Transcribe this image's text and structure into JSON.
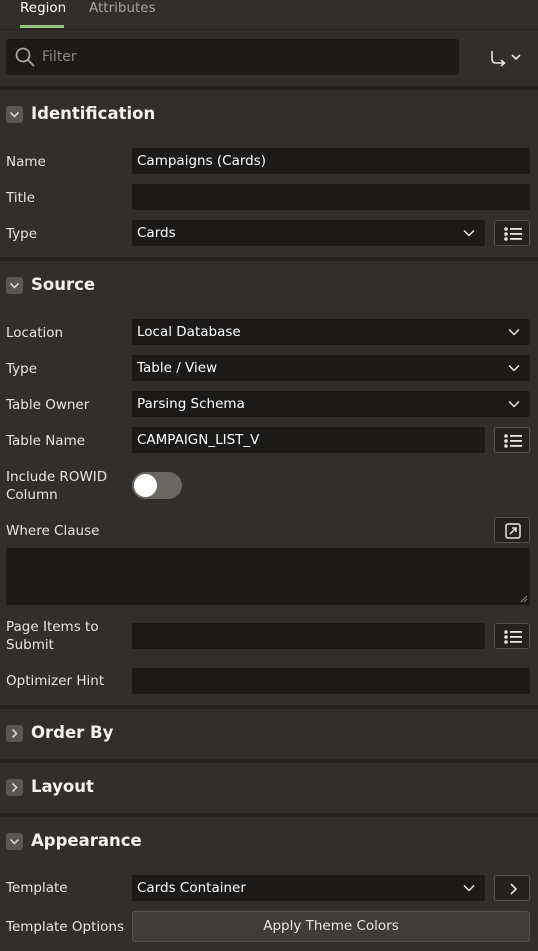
{
  "tabs": {
    "region": "Region",
    "attributes": "Attributes"
  },
  "filter": {
    "placeholder": "Filter"
  },
  "sections": {
    "identification": {
      "title": "Identification",
      "name_label": "Name",
      "name_value": "Campaigns (Cards)",
      "title_label": "Title",
      "title_value": "",
      "type_label": "Type",
      "type_value": "Cards"
    },
    "source": {
      "title": "Source",
      "location_label": "Location",
      "location_value": "Local Database",
      "type_label": "Type",
      "type_value": "Table / View",
      "owner_label": "Table Owner",
      "owner_value": "Parsing Schema",
      "table_label": "Table Name",
      "table_value": "CAMPAIGN_LIST_V",
      "rowid_label_1": "Include ROWID",
      "rowid_label_2": "Column",
      "rowid_on": false,
      "where_label": "Where Clause",
      "where_value": "",
      "items_label_1": "Page Items to",
      "items_label_2": "Submit",
      "items_value": "",
      "hint_label": "Optimizer Hint",
      "hint_value": ""
    },
    "order_by": {
      "title": "Order By"
    },
    "layout": {
      "title": "Layout"
    },
    "appearance": {
      "title": "Appearance",
      "template_label": "Template",
      "template_value": "Cards Container",
      "options_label": "Template Options",
      "apply_label": "Apply Theme Colors"
    }
  },
  "icons": {
    "search": "search-icon",
    "goto": "goto-group-icon",
    "list": "list-icon",
    "expand": "expand-icon",
    "chevron": "chevron-down-icon",
    "collapse": "chevron-right-icon"
  },
  "colors": {
    "accent": "#94c57c",
    "panel": "#312e2b",
    "field": "#1c1a18",
    "separator": "#24211f"
  }
}
